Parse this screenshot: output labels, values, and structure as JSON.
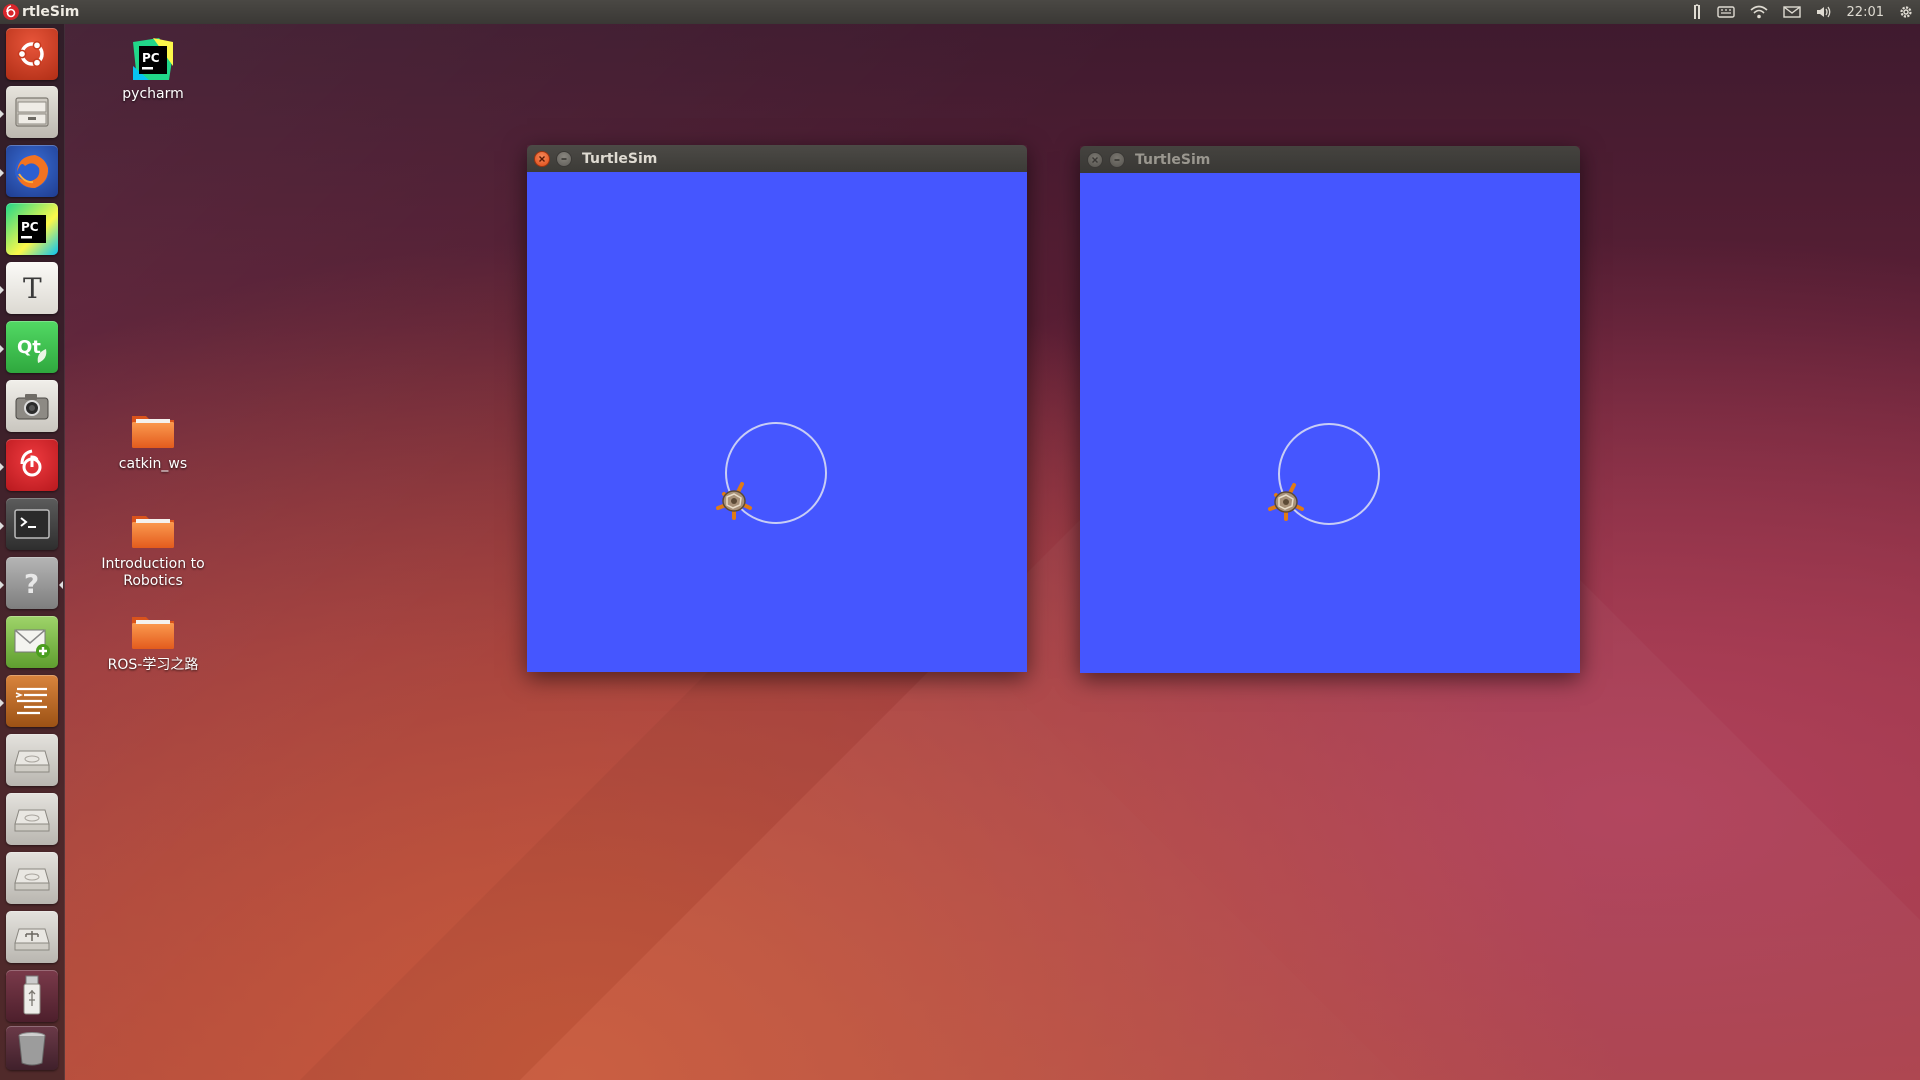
{
  "top_panel": {
    "app_title": "rtleSim",
    "clock": "22:01",
    "tray_icons": [
      "keyboard-input-icon",
      "keyboard-icon",
      "wifi-icon",
      "mail-icon",
      "volume-icon",
      "settings-icon"
    ]
  },
  "launcher": {
    "items": [
      {
        "name": "ubuntu-dash",
        "icon": "ubuntu-logo-icon",
        "color": "#c73a1f"
      },
      {
        "name": "files",
        "icon": "file-cabinet-icon",
        "color": "#d8d4cc"
      },
      {
        "name": "firefox",
        "icon": "firefox-icon",
        "color": "#e86a1c"
      },
      {
        "name": "pycharm",
        "icon": "pycharm-icon",
        "color": "#2aa35a"
      },
      {
        "name": "text-editor",
        "icon": "text-editor-icon",
        "color": "#f2f0ea"
      },
      {
        "name": "qt-creator",
        "icon": "qt-icon",
        "color": "#41cd52"
      },
      {
        "name": "screenshot",
        "icon": "camera-icon",
        "color": "#e4e2dc"
      },
      {
        "name": "netease-music",
        "icon": "netease-music-icon",
        "color": "#d8262b"
      },
      {
        "name": "terminal",
        "icon": "terminal-icon",
        "color": "#3b3b3b"
      },
      {
        "name": "help",
        "icon": "help-icon",
        "color": "#9e9e9e"
      },
      {
        "name": "mail-app",
        "icon": "mail-add-icon",
        "color": "#7cbd4a"
      },
      {
        "name": "sublime",
        "icon": "text-lines-icon",
        "color": "#b5631f"
      },
      {
        "name": "drive-1",
        "icon": "drive-icon",
        "color": "#d7d5d0"
      },
      {
        "name": "drive-2",
        "icon": "drive-icon",
        "color": "#d7d5d0"
      },
      {
        "name": "drive-3",
        "icon": "drive-icon",
        "color": "#d7d5d0"
      },
      {
        "name": "network-drive",
        "icon": "network-drive-icon",
        "color": "#d7d5d0"
      },
      {
        "name": "usb-drive",
        "icon": "usb-icon",
        "color": "#d7d5d0"
      },
      {
        "name": "trash",
        "icon": "trash-icon",
        "color": "#8a8a8a"
      }
    ]
  },
  "desktop": {
    "icons": [
      {
        "label": "pycharm",
        "icon": "pycharm-icon"
      },
      {
        "label": "catkin_ws",
        "icon": "folder-icon"
      },
      {
        "label": "Introduction to Robotics",
        "icon": "folder-icon"
      },
      {
        "label": "ROS-学习之路",
        "icon": "folder-icon"
      }
    ]
  },
  "windows": [
    {
      "title": "TurtleSim",
      "active": true,
      "background": "#4556ff"
    },
    {
      "title": "TurtleSim",
      "active": false,
      "background": "#4556ff"
    }
  ],
  "colors": {
    "turtlesim_bg": "#4556ff",
    "trail": "#c8cdf5",
    "accent_close": "#df4a16"
  }
}
